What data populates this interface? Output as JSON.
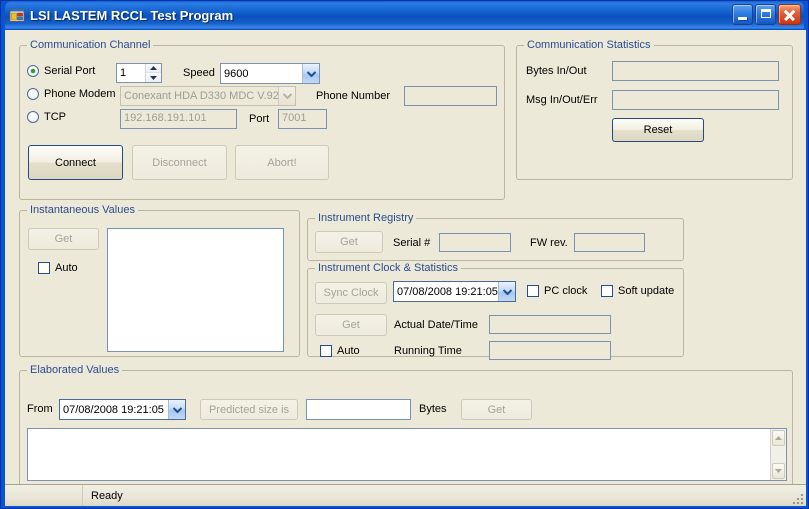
{
  "window": {
    "title": "LSI LASTEM RCCL Test Program",
    "icon": "application-form-icon",
    "minimize_label": "Minimize",
    "maximize_label": "Maximize",
    "close_label": "Close",
    "titlebar_color": "#0f5ecb",
    "form_background": "#ece9d8",
    "group_label_color": "#2b4b8f"
  },
  "communication_channel": {
    "legend": "Communication Channel",
    "serial_port": {
      "radio_label": "Serial Port",
      "selected": true,
      "port_number": "1",
      "speed_label": "Speed",
      "speed_value": "9600"
    },
    "phone_modem": {
      "radio_label": "Phone Modem",
      "selected": false,
      "modem_value": "Conexant HDA D330 MDC V.92",
      "phone_number_label": "Phone Number",
      "phone_number_value": ""
    },
    "tcp": {
      "radio_label": "TCP",
      "selected": false,
      "ip_value": "192.168.191.101",
      "port_label": "Port",
      "port_value": "7001"
    },
    "buttons": {
      "connect": "Connect",
      "disconnect": "Disconnect",
      "abort": "Abort!"
    }
  },
  "communication_statistics": {
    "legend": "Communication Statistics",
    "bytes_label": "Bytes In/Out",
    "bytes_value": "",
    "msg_label": "Msg In/Out/Err",
    "msg_value": "",
    "reset_button": "Reset"
  },
  "instantaneous_values": {
    "legend": "Instantaneous Values",
    "get_button": "Get",
    "auto_label": "Auto",
    "auto_checked": false,
    "list_content": ""
  },
  "instrument_registry": {
    "legend": "Instrument Registry",
    "get_button": "Get",
    "serial_label": "Serial #",
    "serial_value": "",
    "fw_label": "FW rev.",
    "fw_value": ""
  },
  "instrument_clock": {
    "legend": "Instrument Clock & Statistics",
    "sync_button": "Sync Clock",
    "datetime_value": "07/08/2008 19:21:05",
    "pc_clock_label": "PC clock",
    "pc_clock_checked": false,
    "soft_update_label": "Soft update",
    "soft_update_checked": false,
    "get_button": "Get",
    "auto_label": "Auto",
    "auto_checked": false,
    "actual_datetime_label": "Actual Date/Time",
    "actual_datetime_value": "",
    "running_time_label": "Running Time",
    "running_time_value": ""
  },
  "elaborated_values": {
    "legend": "Elaborated Values",
    "from_label": "From",
    "from_value": "07/08/2008 19:21:05",
    "predicted_button": "Predicted size is",
    "predicted_value": "",
    "bytes_label": "Bytes",
    "get_button": "Get",
    "output_content": ""
  },
  "statusbar": {
    "status_text": "Ready",
    "grip": "resize-grip"
  }
}
